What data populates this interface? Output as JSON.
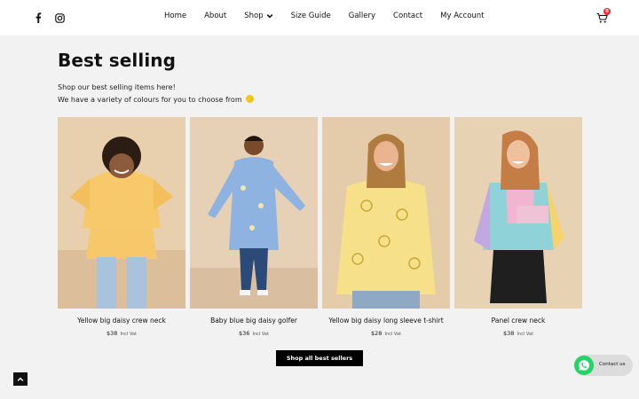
{
  "header": {
    "social_icons": [
      "facebook-icon",
      "instagram-icon"
    ],
    "nav": [
      {
        "label": "Home"
      },
      {
        "label": "About"
      },
      {
        "label": "Shop",
        "has_dropdown": true
      },
      {
        "label": "Size Guide"
      },
      {
        "label": "Gallery"
      },
      {
        "label": "Contact"
      },
      {
        "label": "My Account"
      }
    ],
    "cart": {
      "icon": "cart-icon",
      "count": "0"
    }
  },
  "main": {
    "title": "Best selling",
    "intro_line1": "Shop our best selling items here!",
    "intro_line2": "We have a variety of colours for you to choose from",
    "intro_emoji": "smiley-icon",
    "products": [
      {
        "name": "Yellow big daisy crew neck",
        "price": "$38",
        "vat": "Incl Vat"
      },
      {
        "name": "Baby blue big daisy golfer",
        "price": "$36",
        "vat": "Incl Vat"
      },
      {
        "name": "Yellow big daisy long sleeve t-shirt",
        "price": "$28",
        "vat": "Incl Vat"
      },
      {
        "name": "Panel crew neck",
        "price": "$38",
        "vat": "Incl Vat"
      }
    ],
    "shop_all_label": "Shop all best sellers"
  },
  "widgets": {
    "scroll_top_icon": "chevron-up-icon",
    "whatsapp_label": "Contact us"
  },
  "colors": {
    "background": "#f2f2f2",
    "header": "#ffffff",
    "button": "#000000",
    "badge": "#e4312b",
    "whatsapp": "#25d366"
  }
}
